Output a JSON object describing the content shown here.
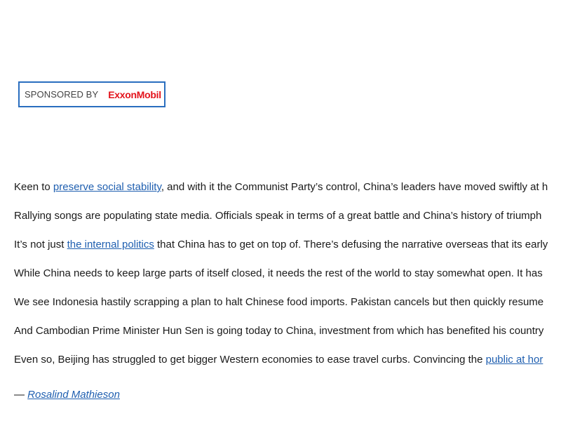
{
  "sponsor": {
    "label": "SPONSORED BY",
    "logo_text": "ExxonMobil",
    "border_color": "#2a6ebf",
    "logo_color": "#e3131b"
  },
  "article": {
    "p1": {
      "before": "Keen to ",
      "link": "preserve social stability",
      "after": ", and with it the Communist Party’s control, China’s leaders have moved swiftly at h"
    },
    "p2": {
      "text": "Rallying songs are populating state media. Officials speak in terms of a great battle and China’s history of triumph"
    },
    "p3": {
      "before": "It’s not just ",
      "link": "the internal politics",
      "after": " that China has to get on top of. There’s defusing the narrative overseas that its early"
    },
    "p4": {
      "text": "While China needs to keep large parts of itself closed, it needs the rest of the world to stay somewhat open. It has"
    },
    "p5": {
      "text": "We see Indonesia hastily scrapping a plan to halt Chinese food imports. Pakistan cancels but then quickly resume"
    },
    "p6": {
      "text": "And Cambodian Prime Minister Hun Sen is going today to China, investment from which has benefited his country"
    },
    "p7": {
      "before": "Even so, Beijing has struggled to get bigger Western economies to ease travel curbs. Convincing the ",
      "link": "public at hor"
    }
  },
  "byline": {
    "dash": "— ",
    "author": "Rosalind Mathieson"
  },
  "colors": {
    "link": "#1f5fb0",
    "text": "#1a1a1a"
  }
}
